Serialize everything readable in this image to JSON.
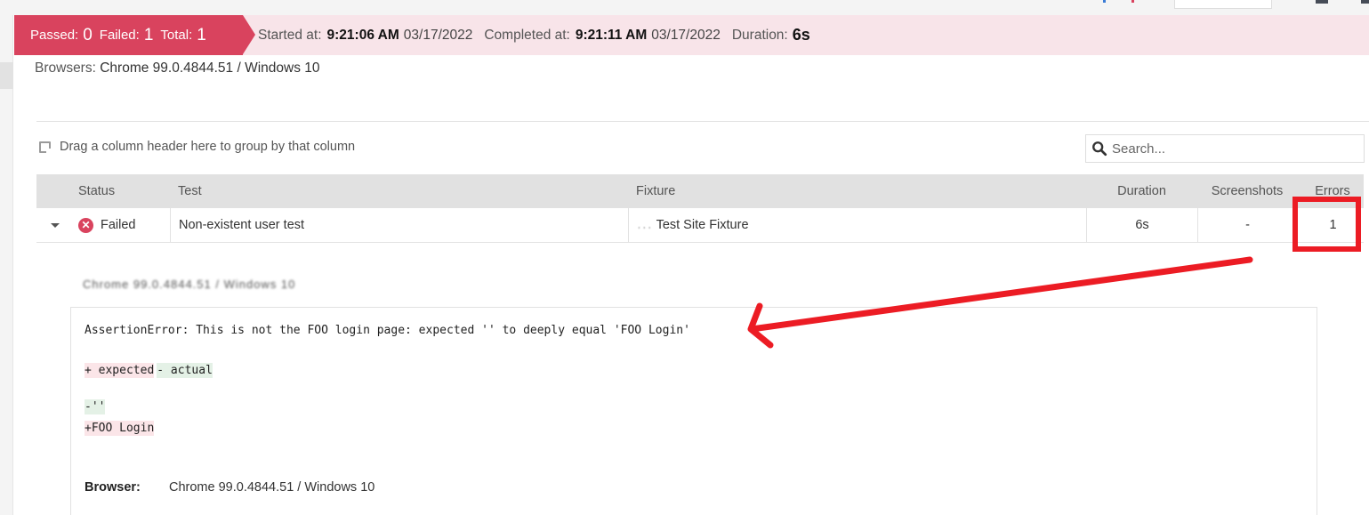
{
  "summary": {
    "passed_label": "Passed:",
    "passed": "0",
    "failed_label": "Failed:",
    "failed": "1",
    "total_label": "Total:",
    "total": "1",
    "started_label": "Started at:",
    "started_time": "9:21:06 AM",
    "started_date": "03/17/2022",
    "completed_label": "Completed at:",
    "completed_time": "9:21:11 AM",
    "completed_date": "03/17/2022",
    "duration_label": "Duration:",
    "duration": "6s",
    "colors": {
      "failed_bg": "#d9435e",
      "banner_bg": "#f8e4e9"
    }
  },
  "browsers": {
    "label": "Browsers:",
    "value": "Chrome 99.0.4844.51 / Windows 10"
  },
  "grid": {
    "group_hint": "Drag a column header here to group by that column",
    "group_icon": "group-by-icon",
    "search": {
      "placeholder": "Search...",
      "value": "",
      "icon": "search-icon"
    },
    "columns": [
      "Status",
      "Test",
      "Fixture",
      "Duration",
      "Screenshots",
      "Errors"
    ],
    "rows": [
      {
        "expanded": true,
        "status": "Failed",
        "status_icon": "failed-x-icon",
        "test": "Non-existent user test",
        "fixture_redacted_prefix": "․․․",
        "fixture": "Test Site Fixture",
        "duration": "6s",
        "screenshots": "-",
        "errors": "1"
      }
    ]
  },
  "detail": {
    "blurred_header": "Chrome 99.0.4844.51 / Windows 10",
    "error_message": "AssertionError: This is not the FOO login page: expected '' to deeply equal 'FOO Login'",
    "legend_expected": "+ expected",
    "legend_actual": "- actual",
    "diff_removed": "-''",
    "diff_added": "+FOO Login",
    "browser_label": "Browser:",
    "browser_value": "Chrome 99.0.4844.51 / Windows 10"
  },
  "annotations": {
    "highlight_color": "#ec1c24",
    "highlight_target": "errors-cell",
    "arrow_target": "error-message"
  }
}
